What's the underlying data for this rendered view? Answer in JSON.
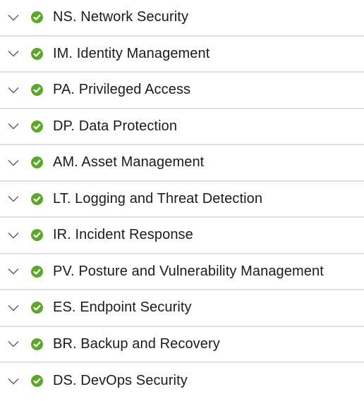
{
  "controls": [
    {
      "id": "ns",
      "label": "NS. Network Security",
      "status": "compliant"
    },
    {
      "id": "im",
      "label": "IM. Identity Management",
      "status": "compliant"
    },
    {
      "id": "pa",
      "label": "PA. Privileged Access",
      "status": "compliant"
    },
    {
      "id": "dp",
      "label": "DP. Data Protection",
      "status": "compliant"
    },
    {
      "id": "am",
      "label": "AM. Asset Management",
      "status": "compliant"
    },
    {
      "id": "lt",
      "label": "LT. Logging and Threat Detection",
      "status": "compliant"
    },
    {
      "id": "ir",
      "label": "IR. Incident Response",
      "status": "compliant"
    },
    {
      "id": "pv",
      "label": "PV. Posture and Vulnerability Management",
      "status": "compliant"
    },
    {
      "id": "es",
      "label": "ES. Endpoint Security",
      "status": "compliant"
    },
    {
      "id": "br",
      "label": "BR. Backup and Recovery",
      "status": "compliant"
    },
    {
      "id": "ds",
      "label": "DS. DevOps Security",
      "status": "compliant"
    }
  ],
  "icons": {
    "expand": "chevron-down-icon",
    "status": "check-circle-icon"
  },
  "colors": {
    "success": "#5ba829",
    "divider": "#e1e1e1",
    "chevron": "#5a5a5a",
    "text": "#1b1b1b"
  }
}
